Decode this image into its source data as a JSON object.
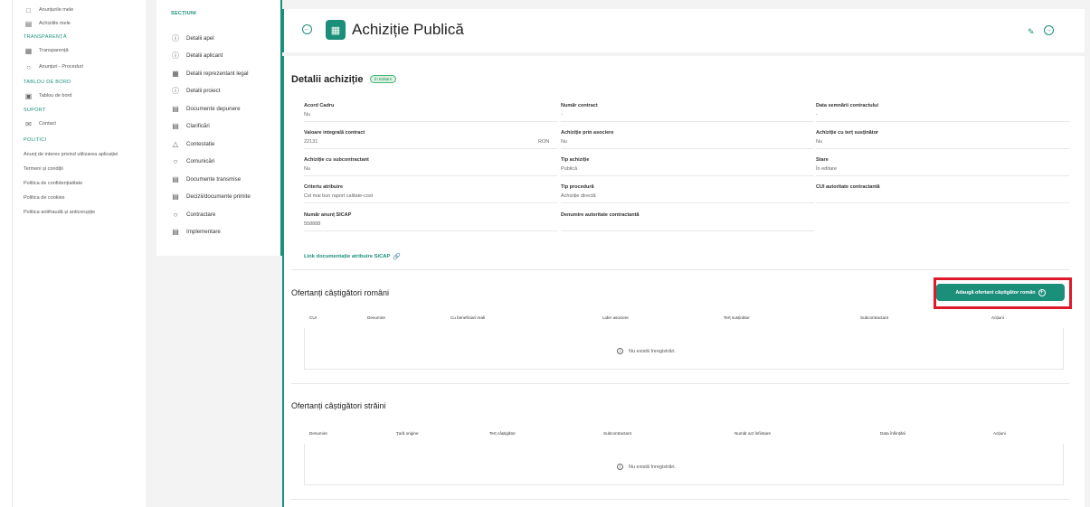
{
  "left_nav": {
    "items": [
      {
        "label": "Anunțurile mele",
        "icon": "folder-icon"
      },
      {
        "label": "Achiziiile mele",
        "icon": "document-icon"
      }
    ],
    "transparenta_header": "TRANSPARENȚĂ",
    "transparenta_items": [
      {
        "label": "Transparență",
        "icon": "table-icon"
      },
      {
        "label": "Anunțuri - Proceduri",
        "icon": "search-doc-icon"
      }
    ],
    "tablou_header": "TABLOU DE BORD",
    "tablou_items": [
      {
        "label": "Tablou de bord",
        "icon": "dashboard-icon"
      }
    ],
    "suport_header": "SUPORT",
    "suport_items": [
      {
        "label": "Contact",
        "icon": "mail-icon"
      }
    ],
    "politici_header": "POLITICI",
    "politici_links": [
      "Anunț de interes privind utilizarea aplicației",
      "Termeni și condiții",
      "Politica de confidențialitate",
      "Politica de cookies",
      "Politica antifraudă și anticorupție"
    ]
  },
  "sections": {
    "title": "SECȚIUNI",
    "items": [
      {
        "label": "Detalii apel",
        "icon": "info-icon"
      },
      {
        "label": "Detalii aplicant",
        "icon": "info-icon"
      },
      {
        "label": "Detalii reprezentant legal",
        "icon": "id-card-icon"
      },
      {
        "label": "Detalii proiect",
        "icon": "info-icon"
      },
      {
        "label": "Documente depunere",
        "icon": "document-icon"
      },
      {
        "label": "Clarificări",
        "icon": "clipboard-icon"
      },
      {
        "label": "Contestatie",
        "icon": "warning-icon"
      },
      {
        "label": "Comunicări",
        "icon": "chat-icon"
      },
      {
        "label": "Documente transmise",
        "icon": "document-icon"
      },
      {
        "label": "Decizii/documente primite",
        "icon": "document-icon"
      },
      {
        "label": "Contractare",
        "icon": "search-doc-icon"
      },
      {
        "label": "Implementare",
        "icon": "calendar-icon"
      }
    ]
  },
  "header": {
    "title": "Achiziție Publică"
  },
  "details": {
    "title": "Detalii achiziție",
    "status_badge": "În Editare",
    "fields": {
      "acord_cadru": {
        "label": "Acord Cadru",
        "value": "Nu"
      },
      "numar_contract": {
        "label": "Număr contract",
        "value": "-"
      },
      "data_semnarii": {
        "label": "Data semnării contractului",
        "value": "-"
      },
      "valoare": {
        "label": "Valoare integrală contract",
        "value": "22131",
        "currency": "RON"
      },
      "achizitie_asociere": {
        "label": "Achiziție prin asociere",
        "value": "Nu"
      },
      "achizitie_tert": {
        "label": "Achiziție cu terț susținător",
        "value": "Nu"
      },
      "achizitie_subcontractant": {
        "label": "Achiziție cu subcontractant",
        "value": "Nu"
      },
      "tip_achizitie": {
        "label": "Tip achiziție",
        "value": "Publică"
      },
      "stare": {
        "label": "Stare",
        "value": "În editare"
      },
      "criteriu": {
        "label": "Criteriu atribuire",
        "value": "Cel mai bun raport calitate-cost"
      },
      "tip_procedura": {
        "label": "Tip procedură",
        "value": "Achiziție directă"
      },
      "cui_autoritate": {
        "label": "CUI autoritate contractantă",
        "value": ""
      },
      "numar_anunt": {
        "label": "Număr anunț SICAP",
        "value": "558888"
      },
      "denumire_autoritate": {
        "label": "Denumire autoritate contractantă",
        "value": ""
      }
    },
    "sicap_link": "Link documentație atribuire SICAP"
  },
  "romani": {
    "title": "Ofertanți câștigători români",
    "add_button": "Adaugă ofertant câștigător român",
    "columns": [
      "CUI",
      "Denumire",
      "Cu beneficiari reali",
      "Lider asociere",
      "Terț susținător",
      "Subcontractant",
      "Acțiuni"
    ],
    "empty": "Nu există înregistrări."
  },
  "straini": {
    "title": "Ofertanți câștigători străini",
    "columns": [
      "Denumire",
      "Țară origine",
      "Terț câștigător",
      "Subcontractant",
      "Număr act înființare",
      "Data înființării",
      "Acțiuni"
    ],
    "empty": "Nu există înregistrări."
  },
  "colors": {
    "accent": "#1b8f7a",
    "highlight": "#e0192a",
    "badge_bg": "#d9f2e4"
  }
}
